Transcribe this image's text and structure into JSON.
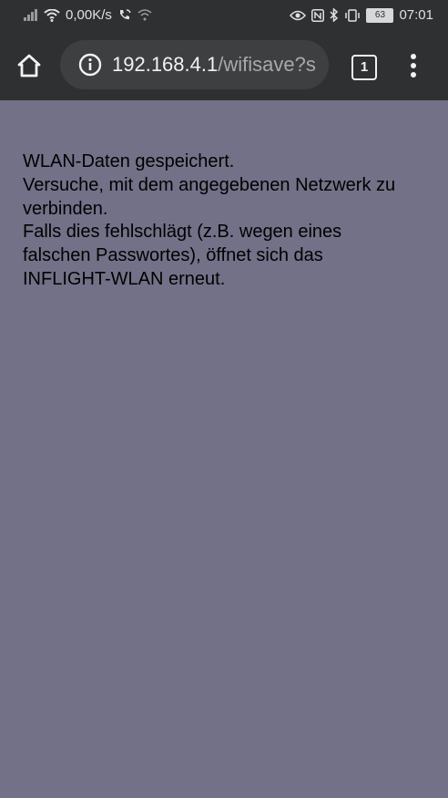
{
  "status_bar": {
    "network_speed": "0,00K/s",
    "battery_level": "63",
    "time": "07:01"
  },
  "browser": {
    "url_host": "192.168.4.1",
    "url_path": "/wifisave?s",
    "tab_count": "1"
  },
  "page": {
    "lines": [
      "WLAN-Daten gespeichert.",
      "Versuche, mit dem angegebenen Netzwerk zu verbinden.",
      "Falls dies fehlschlägt (z.B. wegen eines falschen Passwortes), öffnet sich das INFLIGHT-WLAN erneut."
    ]
  },
  "colors": {
    "page_background": "#727188",
    "browser_chrome": "#2f3031",
    "url_field": "#3d3f41"
  }
}
